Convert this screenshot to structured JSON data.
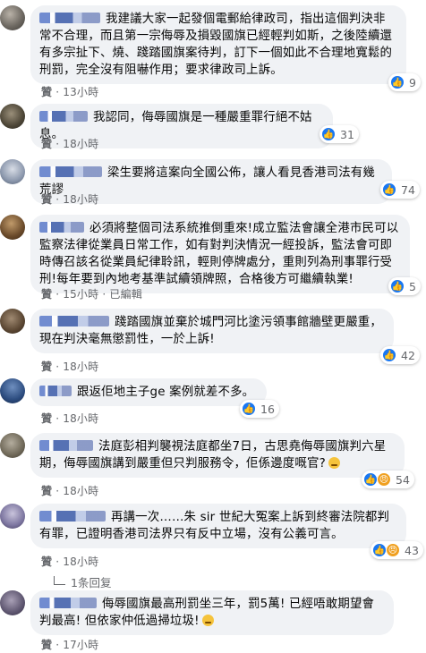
{
  "comments": [
    {
      "text": "我建議大家一起發個電郵給律政司，指出這個判決非常不合理，而且第一宗侮辱及損毀國旗已經輕判如斯，之後陸續還有多宗扯下、燒、踐踏國旗案待判，訂下一個如此不合理地寬鬆的刑罰，完全沒有阻嚇作用；要求律政司上訴。",
      "like": "贊",
      "time": "13小時",
      "reactions": "9"
    },
    {
      "text": "我認同，侮辱國旗是一種嚴重罪行絕不姑息。",
      "like": "贊",
      "time": "18小時",
      "reactions": "31"
    },
    {
      "text": "梁生要將這案向全國公佈，讓人看見香港司法有幾荒謬",
      "like": "贊",
      "time": "18小時",
      "reactions": "74"
    },
    {
      "text": "必須將整個司法系統推倒重來!成立監法會讓全港市民可以監察法律從業員日常工作，如有對判決情況一經投訴，監法會可即時傳召該名從業員紀律聆訊，輕則停牌處分，重則列為刑事罪行受刑!每年要到內地考基準試續領牌照，合格後方可繼續執業!",
      "like": "贊",
      "time": "15小時",
      "edited": "已編輯",
      "reactions": "5"
    },
    {
      "text": "踐踏國旗並棄於城門河比塗污領事館牆壁更嚴重，現在判決毫無懲罰性，一於上訴!",
      "like": "贊",
      "time": "18小時",
      "reactions": "42"
    },
    {
      "text": "跟返佢地主子ge 案例就差不多。",
      "like": "贊",
      "time": "18小時",
      "reactions": "16"
    },
    {
      "text": "法庭彭相判襲視法庭都坐7日，古思堯侮辱國旗判六星期，侮辱國旗講到嚴重但只判服務令，佢係邊度嘅官?",
      "like": "贊",
      "time": "18小時",
      "reactions": "54"
    },
    {
      "text": "再講一次……朱 sir 世紀大冤案上訴到終審法院都判有罪，已證明香港司法界只有反中立場，沒有公義可言。",
      "like": "贊",
      "time": "18小時",
      "reactions": "43",
      "replies": "1条回复"
    },
    {
      "text": "侮辱國旗最高刑罰坐三年，罰5萬!  已經唔敢期望會判最高!  但依家仲低過掃垃圾!",
      "like": "贊",
      "time": "17小時",
      "reactions": ""
    }
  ],
  "colors": {
    "bubble": "#f0f2f5",
    "like_blue": "#1877f2",
    "meta_gray": "#65676b"
  }
}
